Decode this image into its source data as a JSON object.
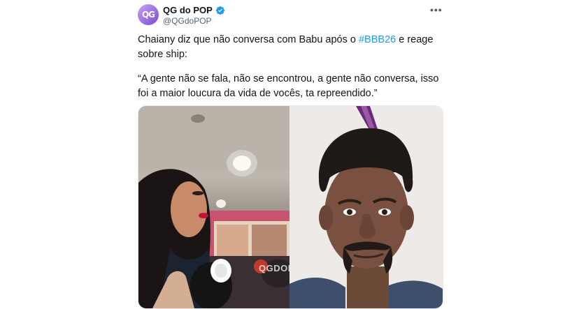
{
  "tweet": {
    "display_name": "QG do POP",
    "handle": "@QGdoPOP",
    "avatar_initials": "QG",
    "text_before_hashtag": "Chaiany diz que não conversa com Babu após o ",
    "hashtag": "#BBB26",
    "text_after_hashtag": " e reage sobre ship:",
    "quote": "“A gente não se fala, não se encontrou, a gente não conversa, isso foi a maior loucura da vida de vocês, ta repreendido.”",
    "more_icon": "more-horizontal-icon",
    "verified_icon": "verified-badge-icon"
  },
  "media": {
    "watermark": "QGDOPOP"
  },
  "colors": {
    "hashtag": "#1d9bf0",
    "verified": "#1d9bf0",
    "secondary_text": "#536471",
    "avatar_accent": "#9d6fe3"
  }
}
